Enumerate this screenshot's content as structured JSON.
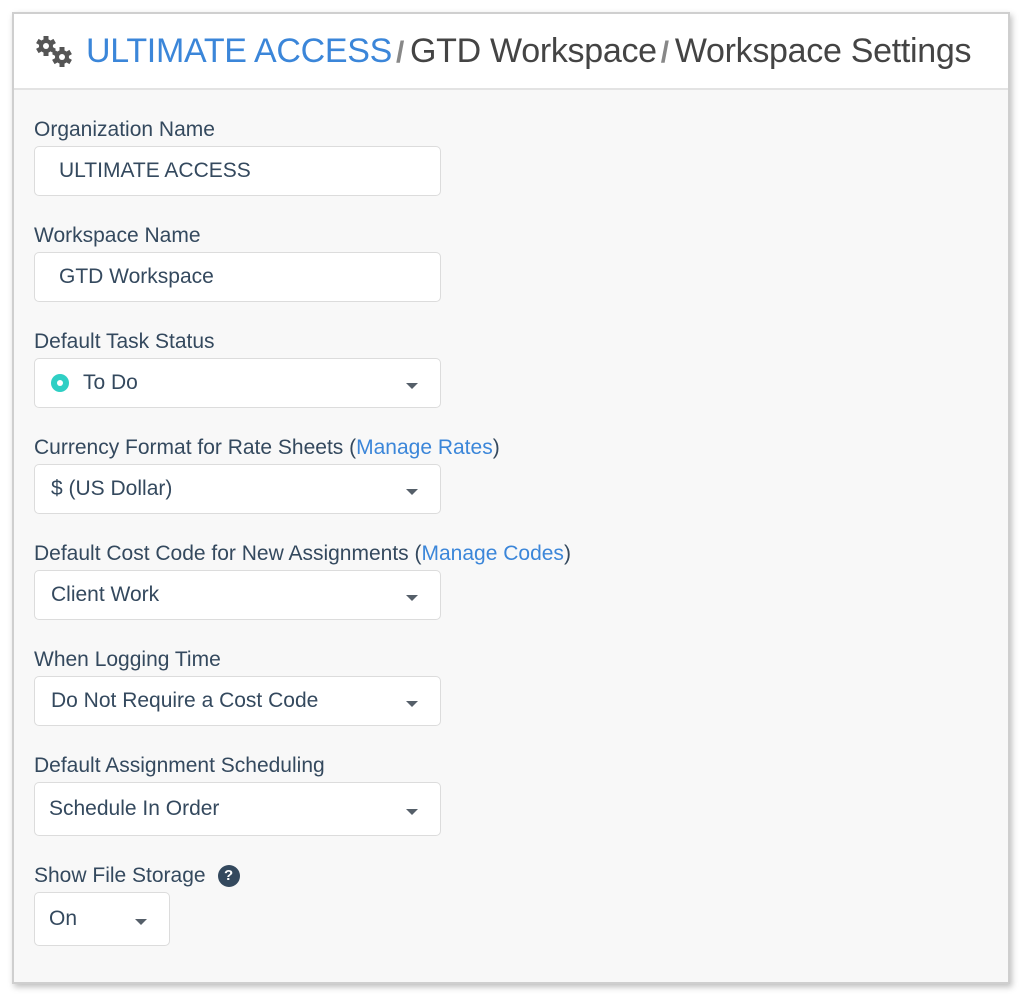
{
  "header": {
    "icon": "gears-icon",
    "breadcrumb": [
      {
        "label": "ULTIMATE ACCESS",
        "link": true
      },
      {
        "label": "GTD Workspace",
        "link": false
      },
      {
        "label": "Workspace Settings",
        "link": false
      }
    ],
    "separator": "/"
  },
  "form": {
    "organization_name": {
      "label": "Organization Name",
      "value": "ULTIMATE ACCESS"
    },
    "workspace_name": {
      "label": "Workspace Name",
      "value": "GTD Workspace"
    },
    "default_task_status": {
      "label": "Default Task Status",
      "value": "To Do",
      "status_color": "#2fcfc4"
    },
    "currency_format": {
      "label": "Currency Format for Rate Sheets (",
      "link": "Manage Rates",
      "label_end": ")",
      "value": "$ (US Dollar)"
    },
    "default_cost_code": {
      "label": "Default Cost Code for New Assignments (",
      "link": "Manage Codes",
      "label_end": ")",
      "value": "Client Work"
    },
    "logging_time": {
      "label": "When Logging Time",
      "value": "Do Not Require a Cost Code"
    },
    "assignment_scheduling": {
      "label": "Default Assignment Scheduling",
      "value": "Schedule In Order"
    },
    "file_storage": {
      "label": "Show File Storage",
      "help": "?",
      "value": "On"
    }
  },
  "colors": {
    "link": "#3b86d9",
    "text": "#34495e",
    "status": "#2fcfc4"
  }
}
